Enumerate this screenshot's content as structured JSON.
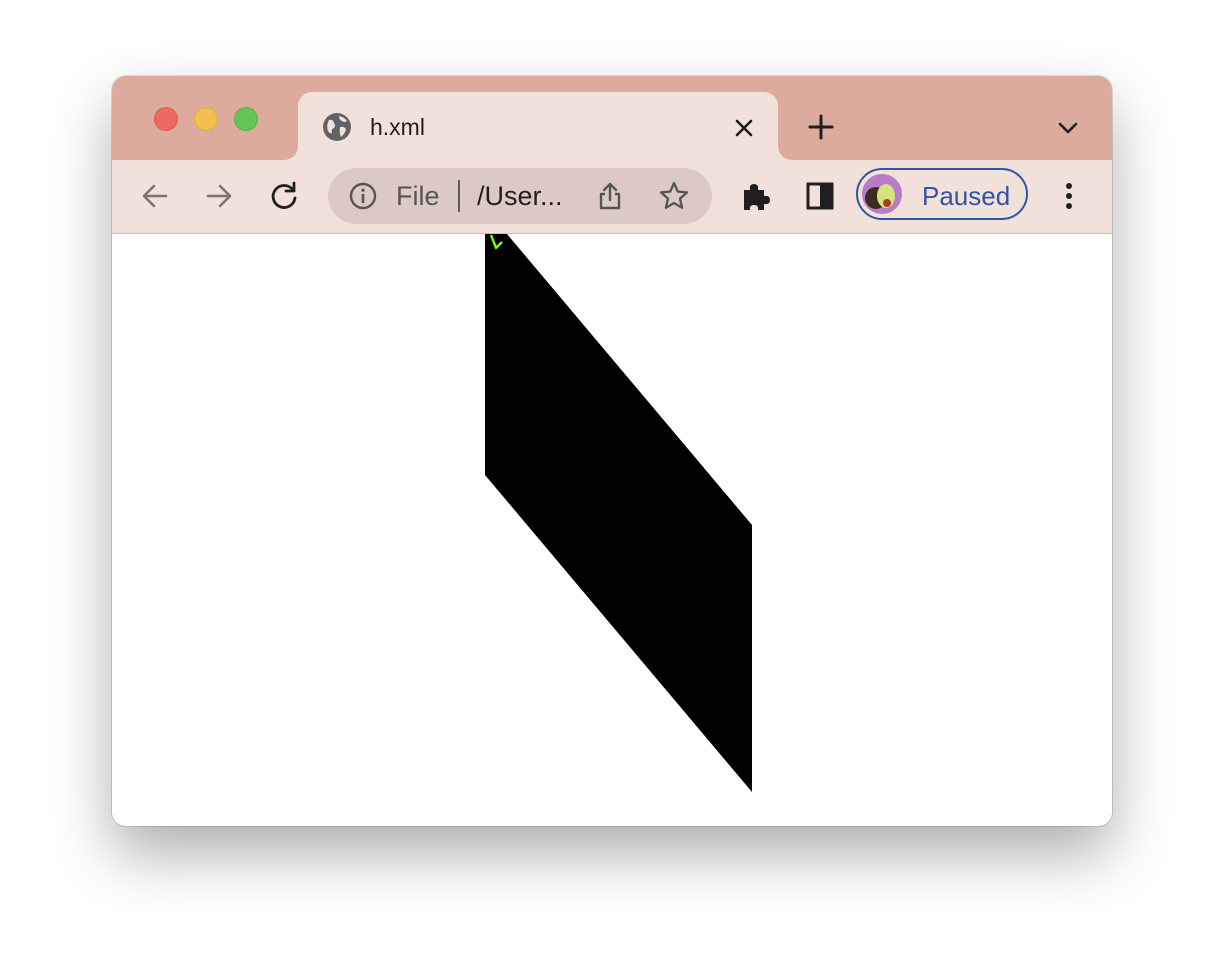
{
  "window": {
    "traffic_lights": [
      "close",
      "minimize",
      "maximize"
    ]
  },
  "tab": {
    "favicon": "globe-icon",
    "title": "h.xml",
    "close_icon": "close-icon"
  },
  "tabstrip": {
    "new_tab_icon": "plus-icon",
    "tab_search_icon": "chevron-down-icon"
  },
  "toolbar": {
    "back_icon": "arrow-left-icon",
    "forward_icon": "arrow-right-icon",
    "reload_icon": "reload-icon",
    "omnibox": {
      "info_icon": "info-icon",
      "scheme": "File",
      "url": "/User...",
      "share_icon": "share-icon",
      "bookmark_icon": "star-icon"
    },
    "extensions_icon": "puzzle-icon",
    "side_panel_icon": "side-panel-icon",
    "profile": {
      "label": "Paused",
      "avatar": "avocado-avatar"
    },
    "menu_icon": "kebab-menu-icon"
  },
  "colors": {
    "tabstrip_bg": "#dcab9d",
    "toolbar_bg": "#f2e1db",
    "omnibox_bg": "#dcc9c3",
    "profile_accent": "#2f56a5",
    "shape_fill": "#000000",
    "marker_stroke": "#7fff00"
  },
  "content": {
    "shapes": [
      {
        "name": "black-parallelogram",
        "fill": "#000000"
      },
      {
        "name": "green-marker",
        "stroke": "#7fff00"
      }
    ]
  }
}
